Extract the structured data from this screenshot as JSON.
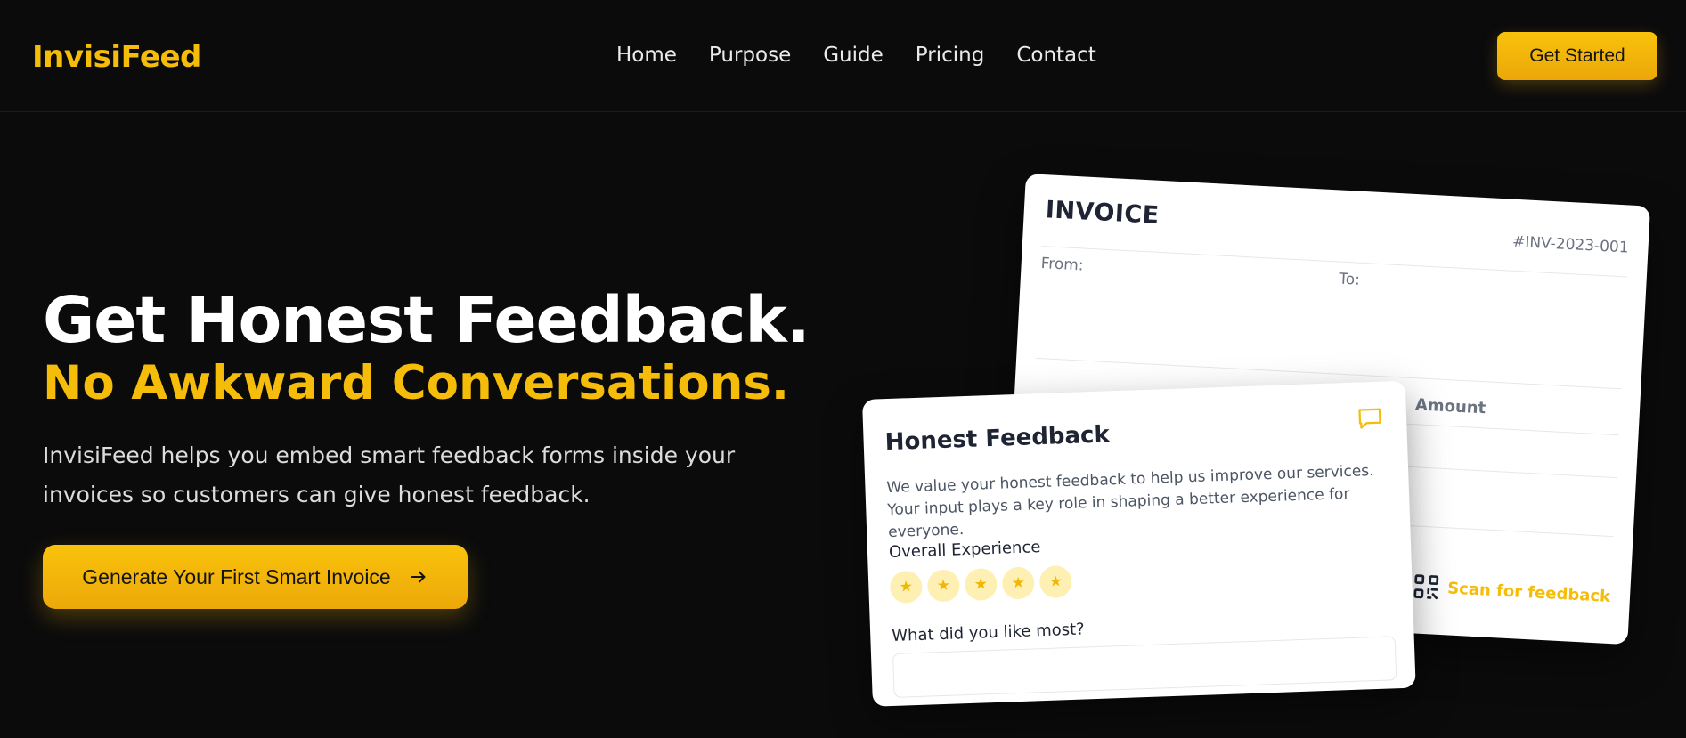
{
  "header": {
    "logo": "InvisiFeed",
    "nav": [
      "Home",
      "Purpose",
      "Guide",
      "Pricing",
      "Contact"
    ],
    "cta": "Get Started"
  },
  "hero": {
    "title": "Get Honest Feedback.",
    "subtitle": "No Awkward Conversations.",
    "description": "InvisiFeed helps you embed smart feedback forms inside your invoices so customers can give honest feedback.",
    "cta": "Generate Your First Smart Invoice"
  },
  "invoice": {
    "title": "INVOICE",
    "number": "#INV-2023-001",
    "from_label": "From:",
    "to_label": "To:",
    "amount_label": "Amount",
    "scan_label": "Scan for feedback"
  },
  "feedback": {
    "title": "Honest Feedback",
    "description": "We value your honest feedback to help us improve our services. Your input plays a key role in shaping a better experience for everyone.",
    "experience_label": "Overall Experience",
    "rating_max": 5,
    "star_glyph": "★",
    "like_label": "What did you like most?",
    "like_value": ""
  },
  "colors": {
    "accent": "#f5bd0a",
    "background": "#0b0b0c",
    "card": "#ffffff",
    "text_dark": "#1e2433"
  },
  "icons": {
    "arrow": "arrow-right-icon",
    "chat": "chat-bubble-icon",
    "qr": "qr-code-icon"
  }
}
